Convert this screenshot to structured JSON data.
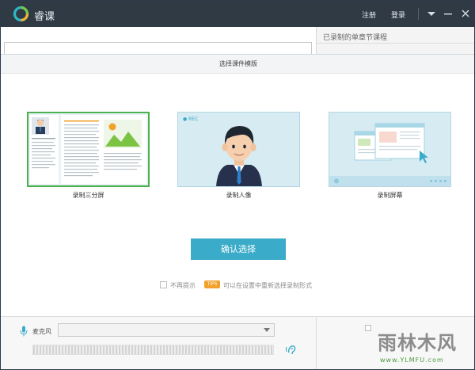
{
  "app": {
    "name": "睿课"
  },
  "titlebar": {
    "register": "注册",
    "login": "登录"
  },
  "background": {
    "right_panel_label": "已录制的单章节课程"
  },
  "dialog": {
    "title": "选择课件模版",
    "options": [
      {
        "label": "录制三分屏",
        "selected": true
      },
      {
        "label": "录制人像",
        "selected": false,
        "rec_badge": "● REC"
      },
      {
        "label": "录制屏幕",
        "selected": false
      }
    ],
    "confirm_label": "确认选择",
    "no_remind": "不再提示",
    "tips_badge": "TIPS",
    "tip_text": "可以在设置中重新选择录制形式"
  },
  "bottom": {
    "mic_label": "麦克风",
    "mic_value": ""
  },
  "watermark": {
    "text": "雨林木风",
    "url": "www.YLMFU.com"
  },
  "colors": {
    "titlebar": "#2f3a45",
    "accent": "#3aabc8",
    "selected_border": "#4cb04f",
    "tips": "#f2a12a"
  }
}
